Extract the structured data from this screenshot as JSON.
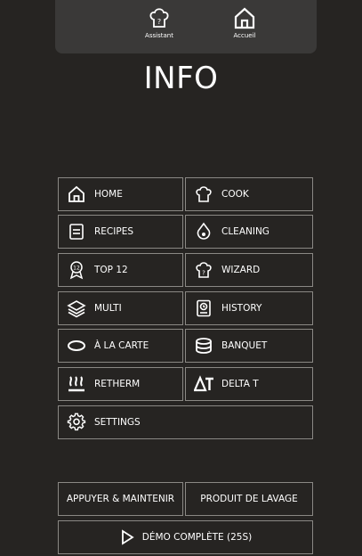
{
  "topbar": {
    "assistant_label": "Assistant",
    "home_label": "Accueil"
  },
  "page_title": "INFO",
  "menu": {
    "home": "HOME",
    "cook": "COOK",
    "recipes": "RECIPES",
    "cleaning": "CLEANING",
    "top12": "TOP 12",
    "wizard": "WIZARD",
    "multi": "MULTI",
    "history": "HISTORY",
    "a_la_carte": "À LA CARTE",
    "banquet": "BANQUET",
    "retherm": "RETHERM",
    "delta_t": "DELTA T",
    "settings": "SETTINGS"
  },
  "actions": {
    "press_hold": "APPUYER & MAINTENIR",
    "cleaning_product": "PRODUIT DE LAVAGE",
    "full_demo": "DÉMO COMPLÈTE (25S)"
  },
  "colors": {
    "background": "#262422",
    "topbar": "#3a3938",
    "button_border": "#8a8884",
    "text": "#ffffff"
  }
}
